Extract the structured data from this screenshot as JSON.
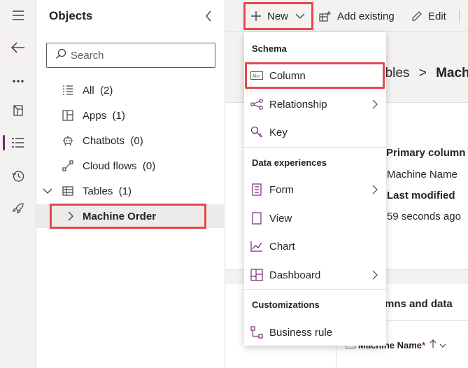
{
  "rail": {
    "items": [
      {
        "icon": "hamburger-icon"
      },
      {
        "icon": "back-arrow-icon"
      },
      {
        "icon": "more-icon"
      },
      {
        "icon": "book-icon"
      },
      {
        "icon": "list-tree-icon"
      },
      {
        "icon": "history-icon"
      },
      {
        "icon": "rocket-icon"
      }
    ]
  },
  "objects": {
    "title": "Objects",
    "search_placeholder": "Search",
    "items": [
      {
        "label": "All",
        "count": "(2)",
        "icon": "list-icon"
      },
      {
        "label": "Apps",
        "count": "(1)",
        "icon": "apps-icon"
      },
      {
        "label": "Chatbots",
        "count": "(0)",
        "icon": "bot-icon"
      },
      {
        "label": "Cloud flows",
        "count": "(0)",
        "icon": "flow-icon"
      },
      {
        "label": "Tables",
        "count": "(1)",
        "icon": "table-icon"
      },
      {
        "label": "Machine Order",
        "count": "",
        "icon": ""
      }
    ]
  },
  "cmdbar": {
    "new_label": "New",
    "add_existing_label": "Add existing",
    "edit_label": "Edit"
  },
  "main": {
    "breadcrumb_part": "ables",
    "breadcrumb_sep": ">",
    "breadcrumb_current": "Mach",
    "primary_column_label": "Primary column",
    "primary_column_value": "Machine Name",
    "last_modified_label": "Last modified",
    "last_modified_value": "59 seconds ago",
    "columns_section_title": "mns and data",
    "column_header": "Machine Name",
    "required_mark": "*"
  },
  "menu": {
    "section_schema": "Schema",
    "section_data_experiences": "Data experiences",
    "section_customizations": "Customizations",
    "items": {
      "column": "Column",
      "relationship": "Relationship",
      "key": "Key",
      "form": "Form",
      "view": "View",
      "chart": "Chart",
      "dashboard": "Dashboard",
      "business_rule": "Business rule"
    }
  },
  "colors": {
    "accent": "#742774",
    "highlight": "#e5484d"
  }
}
